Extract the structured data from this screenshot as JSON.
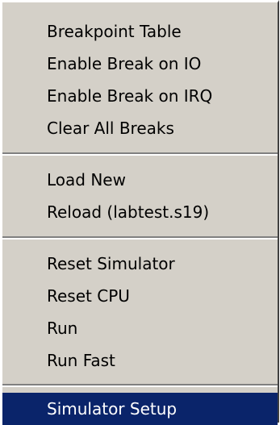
{
  "context_menu": {
    "groups": [
      {
        "items": [
          {
            "label": "Breakpoint Table"
          },
          {
            "label": "Enable Break on IO"
          },
          {
            "label": "Enable Break on IRQ"
          },
          {
            "label": "Clear All Breaks"
          }
        ]
      },
      {
        "items": [
          {
            "label": "Load New"
          },
          {
            "label": "Reload (labtest.s19)"
          }
        ]
      },
      {
        "items": [
          {
            "label": "Reset Simulator"
          },
          {
            "label": "Reset CPU"
          },
          {
            "label": "Run"
          },
          {
            "label": "Run Fast"
          }
        ]
      },
      {
        "items": [
          {
            "label": "Simulator Setup",
            "selected": true
          }
        ]
      }
    ],
    "colors": {
      "menu_background": "#d4d0c8",
      "highlight_background": "#0a246a",
      "highlight_text": "#ffffff",
      "text": "#000000"
    }
  }
}
